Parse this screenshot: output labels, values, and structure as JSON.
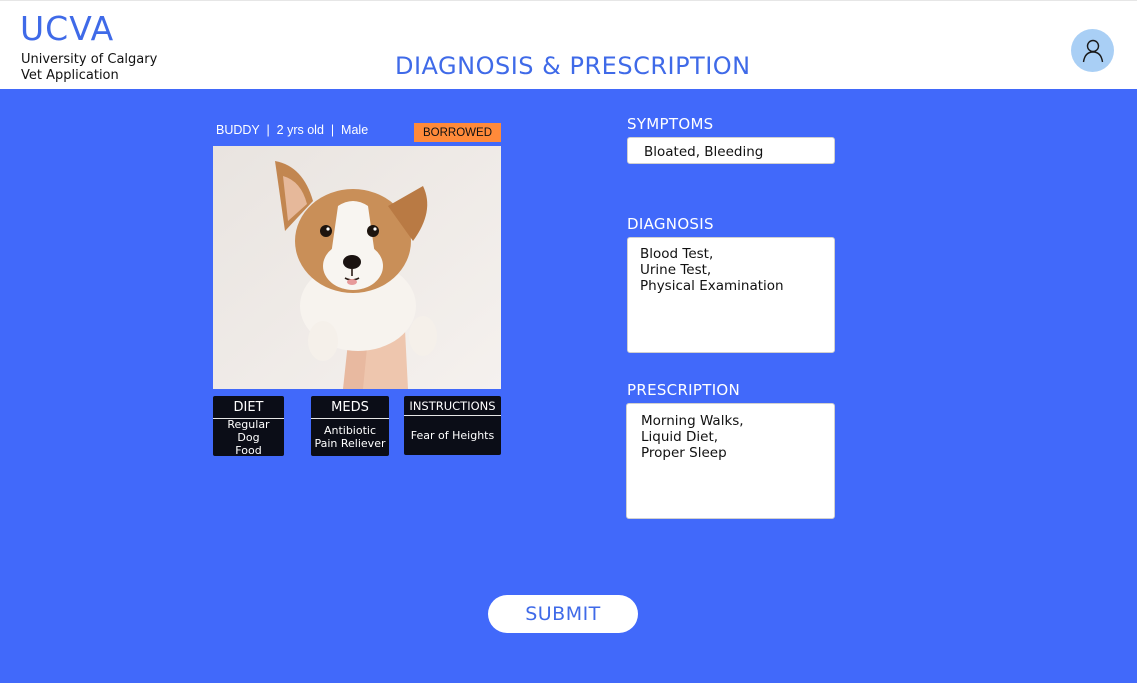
{
  "header": {
    "logo": "UCVA",
    "subtitle_line1": "University of Calgary",
    "subtitle_line2": "Vet Application",
    "page_title": "DIAGNOSIS & PRESCRIPTION",
    "avatar_icon": "user-icon"
  },
  "pet": {
    "info": "BUDDY  |  2 yrs old  |  Male",
    "status_badge": "BORROWED",
    "photo": "puppy-photo"
  },
  "cards": [
    {
      "title": "DIET",
      "line1": "Regular Dog",
      "line2": "Food"
    },
    {
      "title": "MEDS",
      "line1": "Antibiotic",
      "line2": "Pain Reliever"
    },
    {
      "title": "INSTRUCTIONS",
      "line1": "Fear of Heights"
    }
  ],
  "symptoms": {
    "label": "SYMPTOMS",
    "value": "Bloated, Bleeding"
  },
  "diagnosis": {
    "label": "DIAGNOSIS",
    "lines": [
      "Blood Test,",
      "Urine Test,",
      "Physical Examination"
    ]
  },
  "prescription": {
    "label": "PRESCRIPTION",
    "lines": [
      "Morning Walks,",
      "Liquid Diet,",
      "Proper Sleep"
    ]
  },
  "submit_label": "SUBMIT",
  "colors": {
    "accent": "#4169fa",
    "title_blue": "#3f6ae8",
    "badge": "#ff8a3a",
    "card": "#0b0d17",
    "avatar": "#a9cff5"
  }
}
